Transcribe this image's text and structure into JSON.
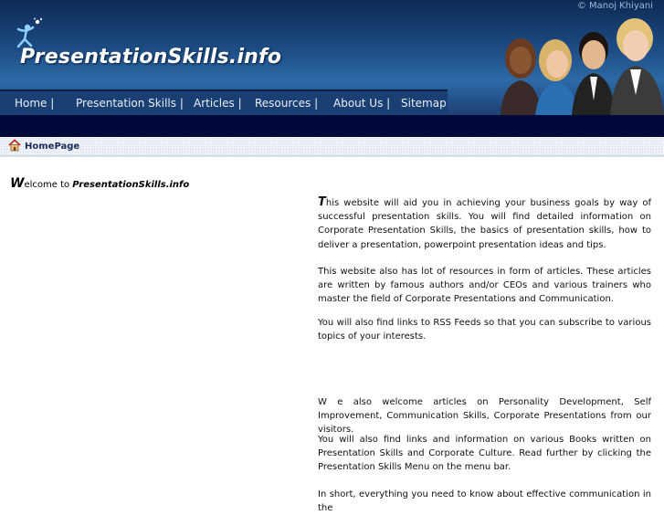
{
  "header": {
    "copyright": "© Manoj Khiyani",
    "site_title": "PresentationSkills.info"
  },
  "nav": {
    "items": [
      {
        "label": "Home |"
      },
      {
        "label": "Presentation Skills |"
      },
      {
        "label": "Articles |"
      },
      {
        "label": "Resources |"
      },
      {
        "label": "About Us |"
      },
      {
        "label": "Sitemap"
      }
    ]
  },
  "breadcrumb": {
    "label": "HomePage"
  },
  "welcome": {
    "first_letter": "W",
    "rest": "elcome to ",
    "site": "PresentationSkills.info"
  },
  "content": {
    "p1_first": "T",
    "p1_rest": "his website will aid you in achieving your business goals by way of successful presentation skills. You will find detailed information on Corporate Presentation Skills, the basics of presentation skills, how to deliver a presentation, powerpoint presentation ideas and tips.",
    "p2": "This website also has lot of resources in form of articles. These articles are written by famous authors and/or CEOs and various trainers who master the field of Corporate Presentations and Communication.",
    "p3": "You will also find links to RSS Feeds so that you can subscribe to various topics of your interests.",
    "p4": "W e also welcome articles on Personality Development, Self Improvement, Communication Skills, Corporate Presentations from our visitors.",
    "p5": "You will also find links and information on various Books written on Presentation Skills and Corporate Culture. Read further by clicking the Presentation Skills Menu on the menu bar.",
    "p6": "In short, everything you need to know about effective communication in the"
  }
}
